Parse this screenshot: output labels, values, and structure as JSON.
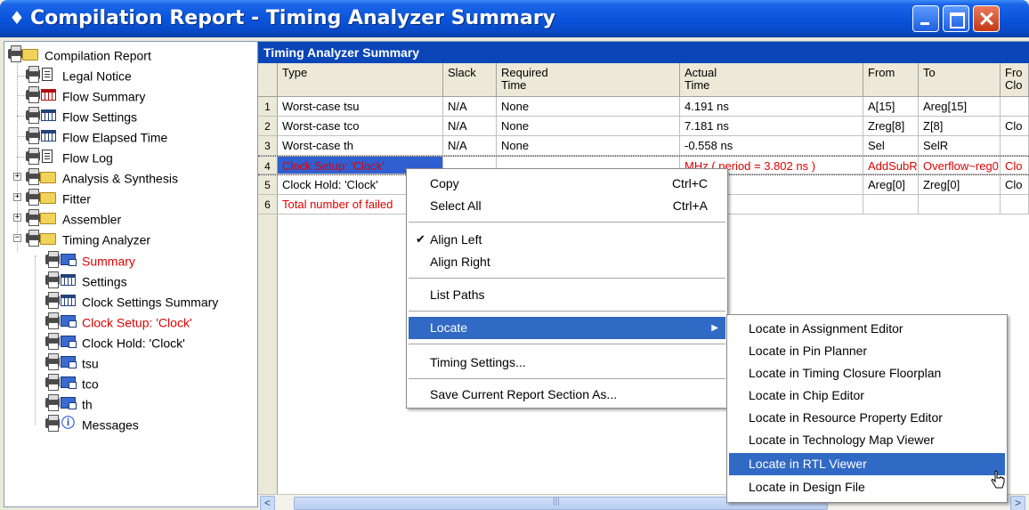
{
  "window": {
    "title": "Compilation Report - Timing Analyzer Summary",
    "title_icon": "♦",
    "accent": "#0a55dc"
  },
  "tree": {
    "items": [
      {
        "label": "Compilation Report",
        "icon": "printer-folder-icon"
      },
      {
        "label": "Legal Notice",
        "icon": "printer-document-icon"
      },
      {
        "label": "Flow Summary",
        "icon": "printer-table-icon"
      },
      {
        "label": "Flow Settings",
        "icon": "printer-table-icon"
      },
      {
        "label": "Flow Elapsed Time",
        "icon": "printer-table-icon"
      },
      {
        "label": "Flow Log",
        "icon": "printer-document-icon"
      },
      {
        "label": "Analysis & Synthesis",
        "icon": "printer-folder-icon"
      },
      {
        "label": "Fitter",
        "icon": "printer-folder-icon"
      },
      {
        "label": "Assembler",
        "icon": "printer-folder-icon"
      },
      {
        "label": "Timing Analyzer",
        "icon": "printer-folder-icon"
      },
      {
        "label": "Summary",
        "icon": "printer-report-icon"
      },
      {
        "label": "Settings",
        "icon": "printer-table-icon"
      },
      {
        "label": "Clock Settings Summary",
        "icon": "printer-table-icon"
      },
      {
        "label": "Clock Setup: 'Clock'",
        "icon": "printer-report-icon"
      },
      {
        "label": "Clock Hold: 'Clock'",
        "icon": "printer-report-icon"
      },
      {
        "label": "tsu",
        "icon": "printer-report-icon"
      },
      {
        "label": "tco",
        "icon": "printer-report-icon"
      },
      {
        "label": "th",
        "icon": "printer-report-icon"
      },
      {
        "label": "Messages",
        "icon": "printer-info-icon"
      }
    ],
    "expander_plus": "+",
    "expander_minus": "−"
  },
  "panel": {
    "header": "Timing Analyzer Summary",
    "columns": [
      "Type",
      "Slack",
      "Required Time",
      "Actual Time",
      "From",
      "To",
      "From Clo"
    ],
    "column_lines": [
      [
        "Type"
      ],
      [
        "Slack"
      ],
      [
        "Required",
        "Time"
      ],
      [
        "Actual",
        "Time"
      ],
      [
        "From"
      ],
      [
        "To"
      ],
      [
        "Fro",
        "Clo"
      ]
    ],
    "rows": [
      {
        "num": "1",
        "cells": [
          "Worst-case tsu",
          "N/A",
          "None",
          "4.191 ns",
          "A[15]",
          "Areg[15]",
          ""
        ]
      },
      {
        "num": "2",
        "cells": [
          "Worst-case tco",
          "N/A",
          "None",
          "7.181 ns",
          "Zreg[8]",
          "Z[8]",
          "Clo"
        ]
      },
      {
        "num": "3",
        "cells": [
          "Worst-case th",
          "N/A",
          "None",
          "-0.558 ns",
          "Sel",
          "SelR",
          ""
        ]
      },
      {
        "num": "4",
        "cells": [
          "Clock Setup: 'Clock'",
          "",
          "",
          "MHz ( period = 3.802 ns )",
          "AddSubR",
          "Overflow~reg0",
          "Clo"
        ]
      },
      {
        "num": "5",
        "cells": [
          "Clock Hold: 'Clock'",
          "",
          "",
          "",
          "Areg[0]",
          "Zreg[0]",
          "Clo"
        ]
      },
      {
        "num": "6",
        "cells": [
          "Total number of failed",
          "",
          "",
          "",
          "",
          "",
          ""
        ]
      }
    ],
    "scroll_left": "<",
    "scroll_right": ">"
  },
  "context_menu": {
    "items": [
      {
        "label": "Copy",
        "shortcut": "Ctrl+C"
      },
      {
        "label": "Select All",
        "shortcut": "Ctrl+A"
      },
      {
        "label": "Align Left",
        "check": "✔"
      },
      {
        "label": "Align Right"
      },
      {
        "label": "List Paths"
      },
      {
        "label": "Locate",
        "arrow": "▶"
      },
      {
        "label": "Timing Settings..."
      },
      {
        "label": "Save Current Report Section As..."
      }
    ]
  },
  "submenu": {
    "items": [
      "Locate in Assignment Editor",
      "Locate in Pin Planner",
      "Locate in Timing Closure Floorplan",
      "Locate in Chip Editor",
      "Locate in Resource Property Editor",
      "Locate in Technology Map Viewer",
      "Locate in RTL Viewer",
      "Locate in Design File"
    ],
    "highlight_color": "#316ac5"
  }
}
